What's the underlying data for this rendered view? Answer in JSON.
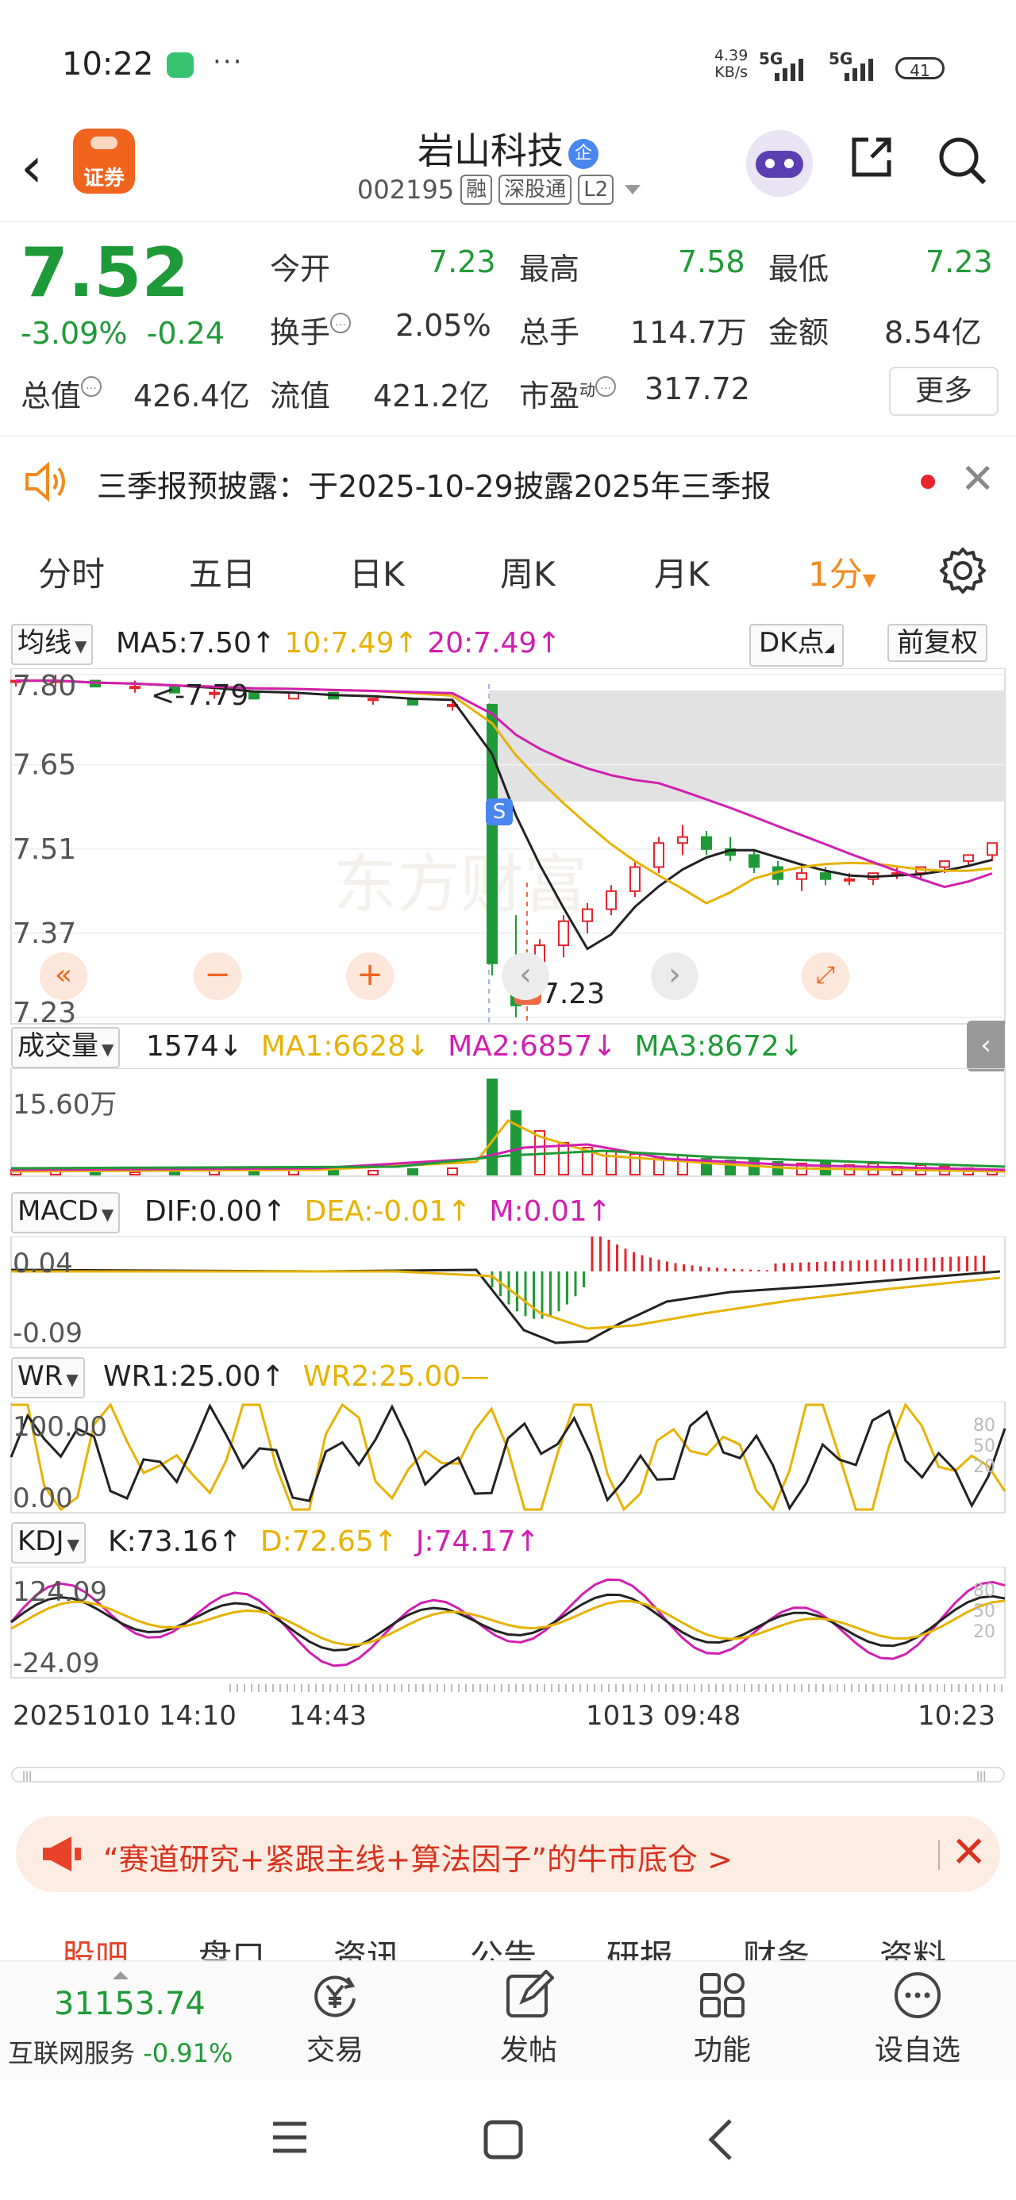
{
  "status_bar": {
    "time": "10:22",
    "more": "···",
    "speed_value": "4.39",
    "speed_unit": "KB/s",
    "net1": "5G",
    "net2": "5G",
    "battery": "41"
  },
  "header": {
    "logo_text": "证券",
    "stock_name": "岩山科技",
    "badge": "企",
    "code": "002195",
    "tags": [
      "融",
      "深股通",
      "L2"
    ]
  },
  "quote": {
    "price": "7.52",
    "change_pct": "-3.09%",
    "change": "-0.24",
    "open_label": "今开",
    "open": "7.23",
    "high_label": "最高",
    "high": "7.58",
    "low_label": "最低",
    "low": "7.23",
    "turnover_label": "换手",
    "turnover": "2.05%",
    "volume_label": "总手",
    "volume": "114.7万",
    "amount_label": "金额",
    "amount": "8.54亿",
    "mcap_label": "总值",
    "mcap": "426.4亿",
    "float_label": "流值",
    "float_cap": "421.2亿",
    "pe_label": "市盈",
    "pe_sup": "动",
    "pe": "317.72",
    "more_label": "更多"
  },
  "notice": {
    "text": "三季报预披露：于2025-10-29披露2025年三季报"
  },
  "tabs": [
    {
      "label": "分时"
    },
    {
      "label": "五日"
    },
    {
      "label": "日K"
    },
    {
      "label": "周K"
    },
    {
      "label": "月K"
    },
    {
      "label": "1分"
    }
  ],
  "active_tab": "1分",
  "ma_bar": {
    "selector": "均线",
    "ma5": "MA5:7.50",
    "ma10": "10:7.49",
    "ma20": "20:7.49",
    "dk": "DK点",
    "adjust": "前复权"
  },
  "price_axis": [
    "7.80",
    "7.65",
    "7.51",
    "7.37",
    "7.23"
  ],
  "marks": {
    "high_mark": "<-7.79",
    "low_mark": "7.23",
    "sell": "S",
    "buy": "B"
  },
  "volume_bar": {
    "selector": "成交量",
    "value": "1574",
    "ma1": "MA1:6628",
    "ma2": "MA2:6857",
    "ma3": "MA3:8672",
    "axis_max": "15.60万"
  },
  "macd_bar": {
    "selector": "MACD",
    "dif": "DIF:0.00",
    "dea": "DEA:-0.01",
    "m": "M:0.01",
    "axis_top": "0.04",
    "axis_bottom": "-0.09"
  },
  "wr_bar": {
    "selector": "WR",
    "wr1": "WR1:25.00",
    "wr2": "WR2:25.00",
    "axis_top": "100.00",
    "axis_bottom": "0.00",
    "right_ticks": [
      "80",
      "50",
      "20"
    ]
  },
  "kdj_bar": {
    "selector": "KDJ",
    "k": "K:73.16",
    "d": "D:72.65",
    "j": "J:74.17",
    "axis_top": "124.09",
    "axis_bottom": "-24.09",
    "right_ticks": [
      "80",
      "50",
      "20"
    ]
  },
  "time_axis": [
    "20251010 14:10",
    "14:43",
    "1013 09:48",
    "10:23"
  ],
  "banner": {
    "text": "“赛道研究+紧跟主线+算法因子”的牛市底仓 >"
  },
  "section_tabs": [
    "股吧",
    "盘口",
    "资讯",
    "公告",
    "研报",
    "财务",
    "资料"
  ],
  "bottom_nav": {
    "index_value": "31153.74",
    "index_name": "互联网服务",
    "index_change": "-0.91%",
    "items": [
      {
        "label": "交易"
      },
      {
        "label": "发帖"
      },
      {
        "label": "功能"
      },
      {
        "label": "设自选"
      }
    ]
  },
  "colors": {
    "up": "#e8242e",
    "down": "#1f9a38",
    "accent": "#f08a1e",
    "ma5": "#222222",
    "ma10": "#e7b200",
    "ma20": "#d11fb0"
  },
  "chart_data": {
    "type": "candlestick",
    "interval": "1分",
    "ylim": [
      7.23,
      7.8
    ],
    "ohlc": [
      [
        7.79,
        7.79,
        7.78,
        7.79
      ],
      [
        7.79,
        7.8,
        7.78,
        7.79
      ],
      [
        7.79,
        7.79,
        7.78,
        7.78
      ],
      [
        7.78,
        7.79,
        7.77,
        7.78
      ],
      [
        7.78,
        7.78,
        7.77,
        7.77
      ],
      [
        7.77,
        7.78,
        7.76,
        7.77
      ],
      [
        7.77,
        7.77,
        7.76,
        7.76
      ],
      [
        7.76,
        7.77,
        7.76,
        7.77
      ],
      [
        7.77,
        7.77,
        7.76,
        7.76
      ],
      [
        7.76,
        7.76,
        7.75,
        7.76
      ],
      [
        7.76,
        7.76,
        7.75,
        7.75
      ],
      [
        7.75,
        7.76,
        7.74,
        7.75
      ],
      [
        7.75,
        7.75,
        7.3,
        7.32
      ],
      [
        7.32,
        7.4,
        7.23,
        7.25
      ],
      [
        7.3,
        7.36,
        7.27,
        7.35
      ],
      [
        7.35,
        7.4,
        7.33,
        7.39
      ],
      [
        7.39,
        7.42,
        7.37,
        7.41
      ],
      [
        7.41,
        7.45,
        7.4,
        7.44
      ],
      [
        7.44,
        7.49,
        7.43,
        7.48
      ],
      [
        7.48,
        7.53,
        7.47,
        7.52
      ],
      [
        7.52,
        7.55,
        7.5,
        7.53
      ],
      [
        7.53,
        7.54,
        7.5,
        7.51
      ],
      [
        7.51,
        7.53,
        7.49,
        7.5
      ],
      [
        7.5,
        7.51,
        7.47,
        7.48
      ],
      [
        7.48,
        7.49,
        7.45,
        7.46
      ],
      [
        7.46,
        7.48,
        7.44,
        7.47
      ],
      [
        7.47,
        7.48,
        7.45,
        7.46
      ],
      [
        7.46,
        7.47,
        7.45,
        7.46
      ],
      [
        7.46,
        7.47,
        7.45,
        7.47
      ],
      [
        7.47,
        7.48,
        7.46,
        7.47
      ],
      [
        7.47,
        7.48,
        7.46,
        7.48
      ],
      [
        7.48,
        7.49,
        7.47,
        7.49
      ],
      [
        7.49,
        7.5,
        7.48,
        7.5
      ],
      [
        7.5,
        7.52,
        7.49,
        7.52
      ]
    ],
    "volume_max": 156000
  }
}
